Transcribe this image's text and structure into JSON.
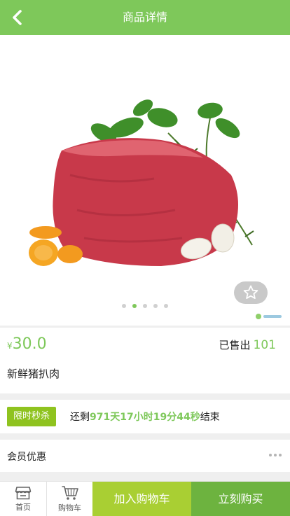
{
  "header": {
    "title": "商品详情",
    "back_icon": "chevron-left-icon"
  },
  "gallery": {
    "slides": 5,
    "active_index": 1,
    "favorite_icon": "star-outline-icon"
  },
  "product": {
    "currency_symbol": "¥",
    "price": "30.0",
    "sold_label": "已售出",
    "sold_count": "101",
    "name": "新鲜猪扒肉"
  },
  "flash_sale": {
    "badge": "限时秒杀",
    "prefix": "还剩",
    "days": "971",
    "unit_day": "天",
    "hours": "17",
    "unit_hour": "小时",
    "minutes": "19",
    "unit_minute": "分",
    "seconds": "44",
    "unit_second": "秒",
    "suffix": "结束"
  },
  "member": {
    "label": "会员优惠"
  },
  "bottom_bar": {
    "home_label": "首页",
    "cart_label": "购物车",
    "add_to_cart": "加入购物车",
    "buy_now": "立刻购买"
  },
  "colors": {
    "brand": "#7ec85a",
    "add_cart": "#a9cf33",
    "buy_now": "#6db33f",
    "flash_badge": "#8fc31f"
  }
}
